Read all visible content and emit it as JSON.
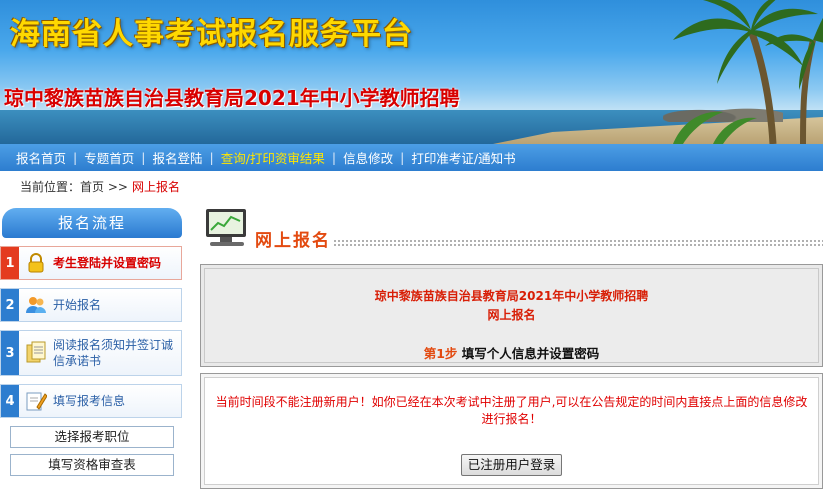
{
  "banner": {
    "site_title": "海南省人事考试报名服务平台",
    "exam_title": "琼中黎族苗族自治县教育局2021年中小学教师招聘"
  },
  "nav": {
    "items": [
      "报名首页",
      "专题首页",
      "报名登陆",
      "查询/打印资审结果",
      "信息修改",
      "打印准考证/通知书"
    ],
    "separator": "|",
    "active_index": 3
  },
  "breadcrumb": {
    "label": "当前位置：首页 >>",
    "current": "网上报名"
  },
  "sidebar": {
    "title": "报名流程",
    "steps": [
      {
        "num": "1",
        "label": "考生登陆并设置密码",
        "icon": "lock-icon"
      },
      {
        "num": "2",
        "label": "开始报名",
        "icon": "users-icon"
      },
      {
        "num": "3",
        "label": "阅读报名须知并签订诚信承诺书",
        "icon": "documents-icon"
      },
      {
        "num": "4",
        "label": "填写报考信息",
        "icon": "pencil-form-icon"
      }
    ],
    "sub_buttons": [
      "选择报考职位",
      "填写资格审查表"
    ]
  },
  "main": {
    "section_title": "网上报名",
    "panel": {
      "exam_name": "琼中黎族苗族自治县教育局2021年中小学教师招聘",
      "sub_title": "网上报名",
      "step_prefix": "第1步",
      "step_text": "填写个人信息并设置密码"
    },
    "notice": "当前时间段不能注册新用户！如你已经在本次考试中注册了用户,可以在公告规定的时间内直接点上面的信息修改进行报名！",
    "login_button": "已注册用户登录"
  },
  "colors": {
    "accent_red": "#d80000",
    "nav_blue": "#2d7dcf",
    "active_yellow": "#ffe600",
    "title_yellow": "#ffd800",
    "section_orange": "#e34a10"
  }
}
